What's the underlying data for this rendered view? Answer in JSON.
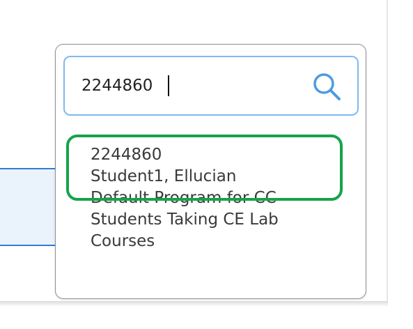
{
  "search": {
    "value": "2244860",
    "icon": "search-icon"
  },
  "results": [
    {
      "id": "2244860",
      "name": "Student1, Ellucian",
      "program_lines": [
        "Default Program for CC",
        "Students Taking CE Lab",
        "Courses"
      ]
    }
  ],
  "colors": {
    "highlight": "#16a34a",
    "search_border": "#7fb8ee",
    "search_icon": "#4f9ae0",
    "field_border": "#2f7dd1",
    "field_bg": "#eaf2fc"
  }
}
